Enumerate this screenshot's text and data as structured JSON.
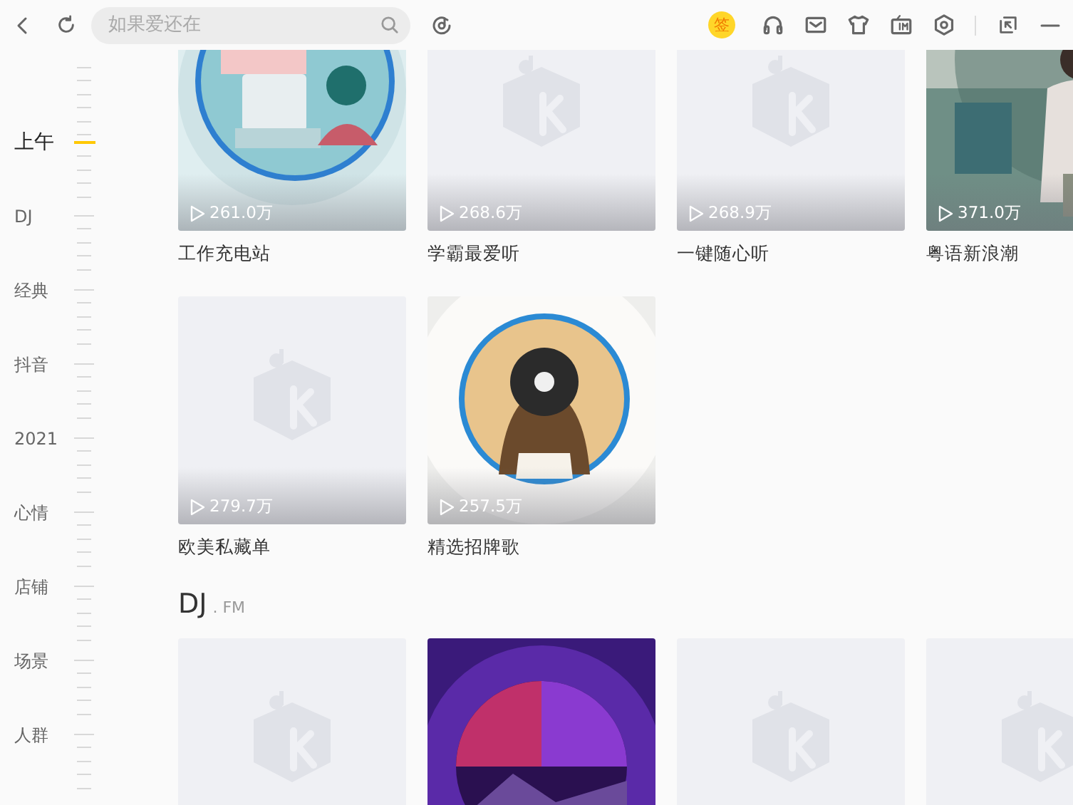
{
  "toolbar": {
    "search": {
      "placeholder": "如果爱还在"
    },
    "sign_badge": "签"
  },
  "nav": [
    {
      "label": "上午",
      "selected": true
    },
    {
      "label": "DJ",
      "selected": false
    },
    {
      "label": "经典",
      "selected": false
    },
    {
      "label": "抖音",
      "selected": false
    },
    {
      "label": "2021",
      "selected": false
    },
    {
      "label": "心情",
      "selected": false
    },
    {
      "label": "店铺",
      "selected": false
    },
    {
      "label": "场景",
      "selected": false
    },
    {
      "label": "人群",
      "selected": false
    }
  ],
  "sections": [
    {
      "rows": [
        [
          {
            "kind": "picture",
            "count": "261.0万",
            "name": "工作充电站"
          },
          {
            "kind": "placeholder",
            "count": "268.6万",
            "name": "学霸最爱听"
          },
          {
            "kind": "placeholder",
            "count": "268.9万",
            "name": "一键随心听"
          },
          {
            "kind": "picture",
            "count": "371.0万",
            "name": "粤语新浪潮"
          }
        ],
        [
          {
            "kind": "placeholder",
            "count": "279.7万",
            "name": "欧美私藏单"
          },
          {
            "kind": "picture",
            "count": "257.5万",
            "name": "精选招牌歌"
          }
        ]
      ]
    },
    {
      "title": "DJ",
      "subtitle": ". FM",
      "rows": [
        [
          {
            "kind": "placeholder"
          },
          {
            "kind": "picture"
          },
          {
            "kind": "placeholder"
          },
          {
            "kind": "placeholder"
          }
        ]
      ]
    }
  ]
}
